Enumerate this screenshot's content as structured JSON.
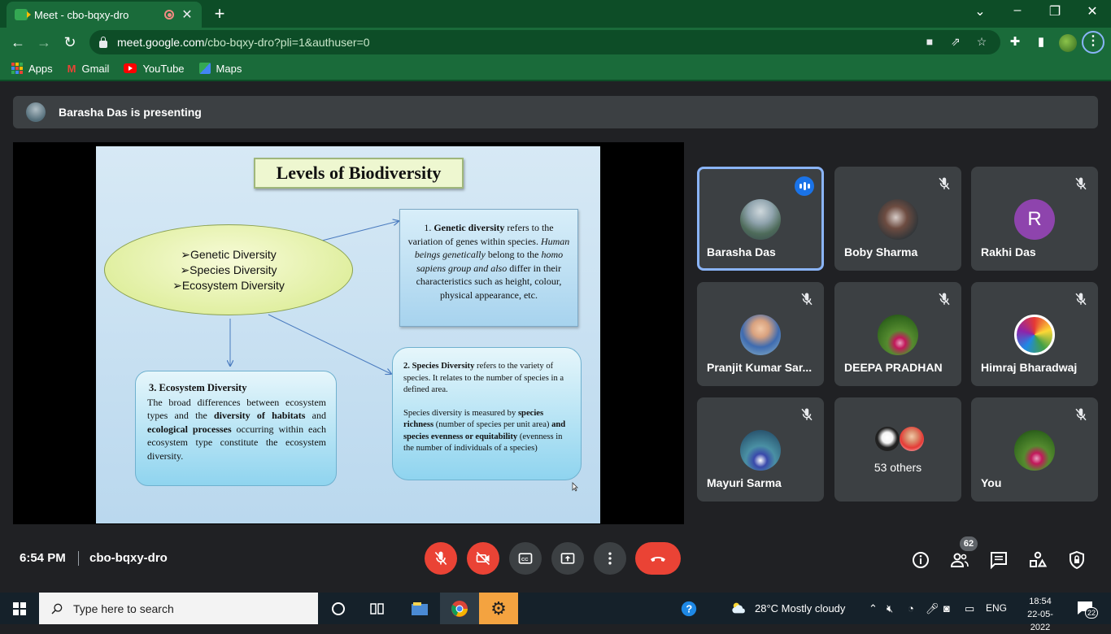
{
  "browser": {
    "tab_title": "Meet - cbo-bqxy-dro",
    "tab_close": "✕",
    "new_tab": "+",
    "url_host": "meet.google.com",
    "url_path": "/cbo-bqxy-dro?pli=1&authuser=0",
    "bookmarks": [
      "Apps",
      "Gmail",
      "YouTube",
      "Maps"
    ]
  },
  "meet": {
    "presenting_text": "Barasha Das is presenting",
    "time": "6:54 PM",
    "meeting_code": "cbo-bqxy-dro",
    "participant_count": "62",
    "participants": [
      {
        "name": "Barasha Das",
        "speaking": true
      },
      {
        "name": "Boby Sharma",
        "muted": true
      },
      {
        "name": "Rakhi Das",
        "initial": "R",
        "muted": true
      },
      {
        "name": "Pranjit Kumar Sar...",
        "muted": true
      },
      {
        "name": "DEEPA PRADHAN",
        "muted": true
      },
      {
        "name": "Himraj Bharadwaj",
        "muted": true
      },
      {
        "name": "Mayuri Sarma",
        "muted": true
      },
      {
        "name": "53 others"
      },
      {
        "name": "You",
        "muted": true
      }
    ]
  },
  "slide": {
    "title": "Levels of Biodiversity",
    "ellipse_items": [
      "➢Genetic Diversity",
      "➢Species Diversity",
      "➢Ecosystem Diversity"
    ],
    "genetic": {
      "p1": "1. ",
      "p2": "Genetic diversity",
      "p3": " refers to the variation of genes within species. ",
      "p4": "Human beings genetically",
      "p5": " belong to the ",
      "p6": "homo sapiens group and also",
      "p7": " differ in their characteristics such as height, colour, physical appearance, etc."
    },
    "ecosystem": {
      "heading": "3. Ecosystem Diversity",
      "p1": "The broad differences between ecosystem types and the ",
      "p2": "diversity of habitats",
      "p3": " and ",
      "p4": "ecological processes",
      "p5": " occurring within each ecosystem type constitute the ecosystem diversity."
    },
    "species": {
      "s1": "2. Species Diversity",
      "s2": " refers to the variety of species. It relates to the number of species in a defined area.",
      "s3": "Species diversity is measured by ",
      "s4": "species richness",
      "s5": " (number of species per unit area) ",
      "s6": "and species evenness or equitability",
      "s7": " (evenness in the number of individuals of a species)"
    }
  },
  "taskbar": {
    "search_placeholder": "Type here to search",
    "weather": "28°C  Mostly cloudy",
    "language": "ENG",
    "clock_time": "18:54",
    "clock_date": "22-05-2022",
    "notifications": "22"
  },
  "colors": {
    "chrome_dark": "#0d4d27",
    "chrome": "#1a6b3a",
    "meet_bg": "#202124",
    "tile": "#3c4043",
    "active_border": "#8ab4f8",
    "end_red": "#ea4335"
  }
}
